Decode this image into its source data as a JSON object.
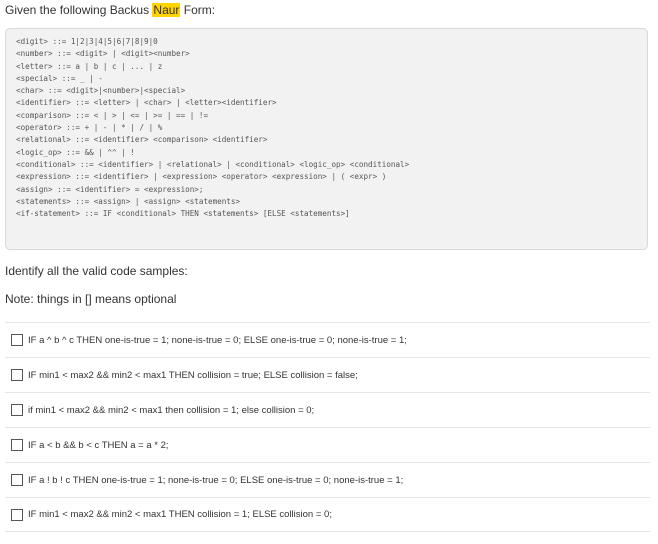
{
  "intro": {
    "prefix": "Given the following Backus ",
    "highlight": "Naur",
    "suffix": " Form:"
  },
  "grammar": [
    "<digit> ::= 1|2|3|4|5|6|7|8|9|0",
    "<number> ::= <digit> | <digit><number>",
    "<letter> ::= a | b | c | ... | z",
    "<special> ::= _ | -",
    "<char> ::= <digit>|<number>|<special>",
    "<identifier> ::= <letter> | <char> | <letter><identifier>",
    "<comparison> ::= < | > | <= | >= | == | !=",
    "<operator> ::= + | - | * | / | %",
    "<relational> ::= <identifier> <comparison> <identifier>",
    "<logic_op> ::= && | ^^ | !",
    "<conditional> ::= <identifier> | <relational> | <conditional> <logic_op> <conditional>",
    "<expression> ::= <identifier> | <expression> <operator> <expression> | ( <expr> )",
    "<assign> ::= <identifier> = <expression>;",
    "<statements> ::= <assign> | <assign> <statements>",
    "<if-statement> ::= IF <conditional> THEN <statements> [ELSE <statements>]"
  ],
  "instruction": "Identify all the valid code samples:",
  "note": "Note: things in [] means optional",
  "options": [
    "IF a ^ b ^ c THEN one-is-true = 1; none-is-true = 0; ELSE one-is-true = 0; none-is-true = 1;",
    "IF min1 < max2 && min2 < max1 THEN collision = true; ELSE collision = false;",
    "if min1 < max2 && min2 < max1 then collision = 1; else collision = 0;",
    "IF a < b && b < c THEN a = a * 2;",
    "IF a ! b ! c THEN one-is-true = 1; none-is-true = 0; ELSE one-is-true = 0; none-is-true = 1;",
    "IF min1 < max2 && min2 < max1 THEN collision = 1; ELSE collision = 0;"
  ]
}
